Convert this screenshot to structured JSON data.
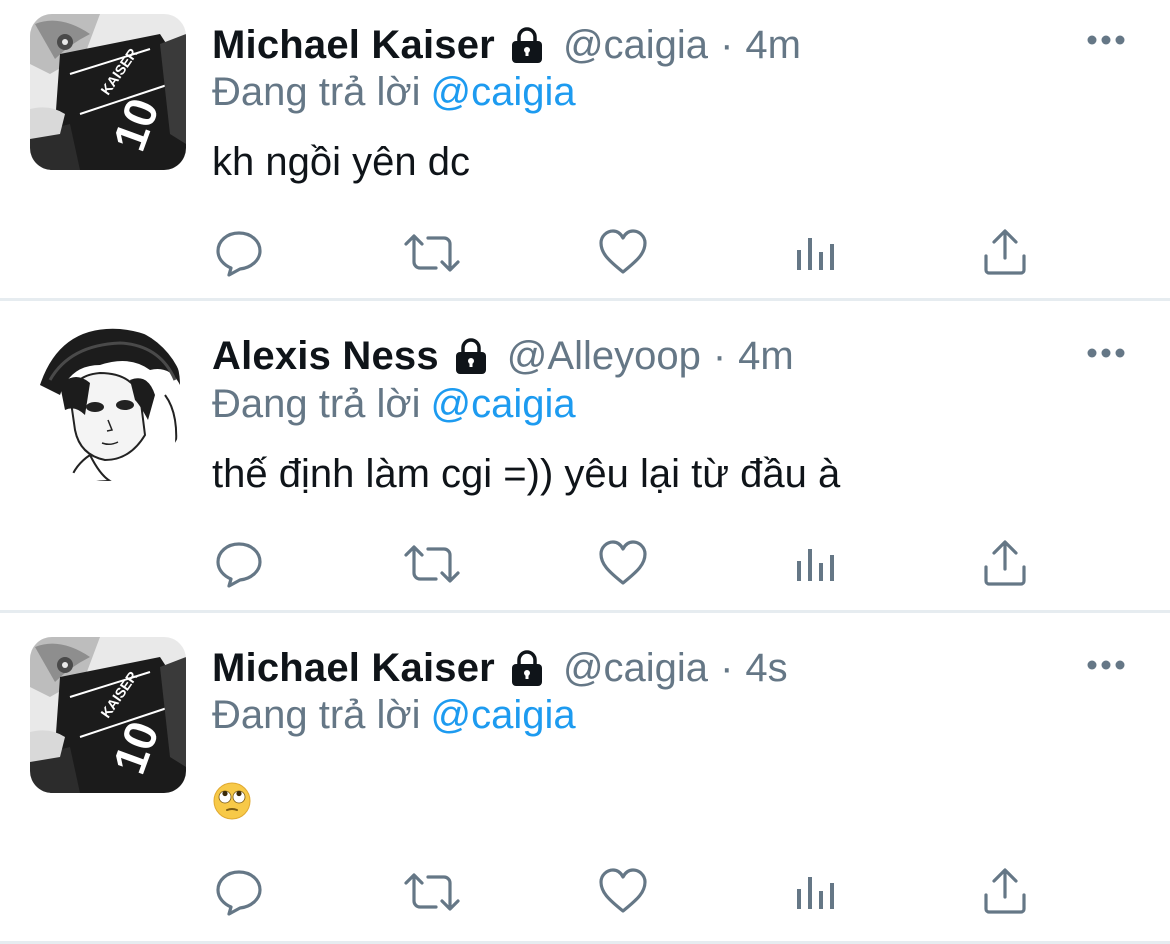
{
  "reply_prefix": "Đang trả lời",
  "colors": {
    "name": "#0f1419",
    "muted": "#657786",
    "mention": "#1d9bf0",
    "divider": "#e6ecf0"
  },
  "icons": [
    "lock-icon",
    "more-icon",
    "reply-icon",
    "retweet-icon",
    "like-icon",
    "analytics-icon",
    "share-icon",
    "face-with-rolling-eyes-emoji"
  ],
  "tweets": [
    {
      "name": "Michael Kaiser",
      "handle": "@caigia",
      "separator": "·",
      "time": "4m",
      "reply_to": "@caigia",
      "text": "kh ngồi yên dc"
    },
    {
      "name": "Alexis Ness",
      "handle": "@Alleyoop",
      "separator": "·",
      "time": "4m",
      "reply_to": "@caigia",
      "text": "thế định làm cgi =)) yêu lại từ đầu à"
    },
    {
      "name": "Michael Kaiser",
      "handle": "@caigia",
      "separator": "·",
      "time": "4s",
      "reply_to": "@caigia",
      "text": "🙄"
    }
  ]
}
